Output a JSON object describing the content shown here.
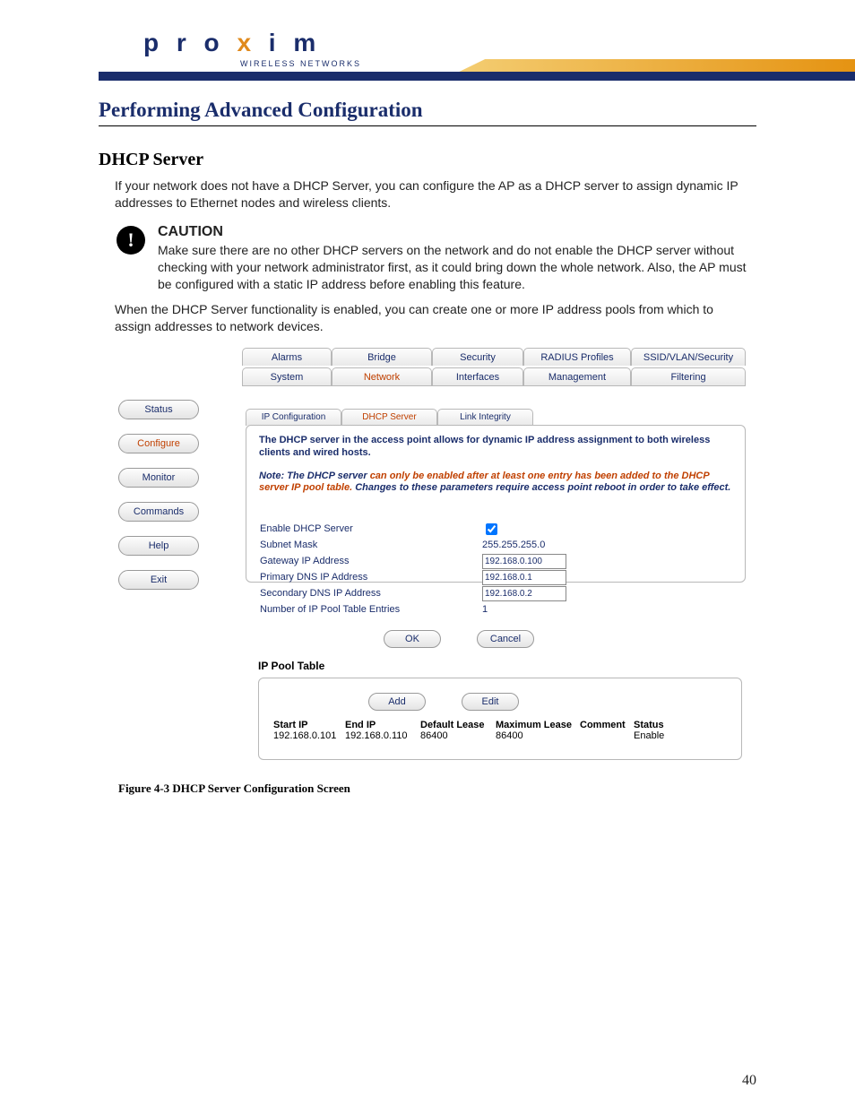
{
  "logo": {
    "brand": "proxim",
    "tagline": "WIRELESS NETWORKS"
  },
  "chapter_title": "Performing Advanced Configuration",
  "section_title": "DHCP Server",
  "intro": "If your network does not have a DHCP Server, you can configure the AP as a DHCP server to assign dynamic IP addresses to Ethernet nodes and wireless clients.",
  "caution": {
    "heading": "CAUTION",
    "body": "Make sure there are no other DHCP servers on the network and do not enable the DHCP server without checking with your network administrator first, as it could bring down the whole network. Also, the AP must be configured with a static IP address before enabling this feature."
  },
  "after_caution": "When the DHCP Server functionality is enabled, you can create one or more IP address pools from which to assign addresses to network devices.",
  "ui": {
    "tabs_top": [
      "Alarms",
      "Bridge",
      "Security",
      "RADIUS Profiles",
      "SSID/VLAN/Security"
    ],
    "tabs_main": [
      "System",
      "Network",
      "Interfaces",
      "Management",
      "Filtering"
    ],
    "tabs_main_active": "Network",
    "side_nav": [
      "Status",
      "Configure",
      "Monitor",
      "Commands",
      "Help",
      "Exit"
    ],
    "side_nav_active": "Configure",
    "subtabs": [
      "IP Configuration",
      "DHCP Server",
      "Link Integrity"
    ],
    "subtabs_active": "DHCP Server",
    "desc": "The DHCP server in the access point allows for dynamic IP address assignment to both wireless clients and wired hosts.",
    "note_prefix": "Note: The DHCP server ",
    "note_warn": "can only be enabled after at least one entry has been added to the DHCP server IP pool table.",
    "note_suffix": " Changes to these parameters require access point reboot in order to take effect.",
    "form": {
      "enable_label": "Enable DHCP Server",
      "enable_checked": true,
      "subnet_label": "Subnet Mask",
      "subnet_value": "255.255.255.0",
      "gateway_label": "Gateway IP Address",
      "gateway_value": "192.168.0.100",
      "primary_dns_label": "Primary DNS IP Address",
      "primary_dns_value": "192.168.0.1",
      "secondary_dns_label": "Secondary DNS IP Address",
      "secondary_dns_value": "192.168.0.2",
      "entries_label": "Number of IP Pool Table Entries",
      "entries_value": "1",
      "ok": "OK",
      "cancel": "Cancel"
    },
    "pool": {
      "title": "IP Pool Table",
      "add": "Add",
      "edit": "Edit",
      "headers": [
        "Start IP",
        "End IP",
        "Default Lease",
        "Maximum Lease",
        "Comment",
        "Status"
      ],
      "row": [
        "192.168.0.101",
        "192.168.0.110",
        "86400",
        "86400",
        "",
        "Enable"
      ]
    }
  },
  "figure_caption": "Figure 4-3    DHCP Server Configuration Screen",
  "page_number": "40"
}
